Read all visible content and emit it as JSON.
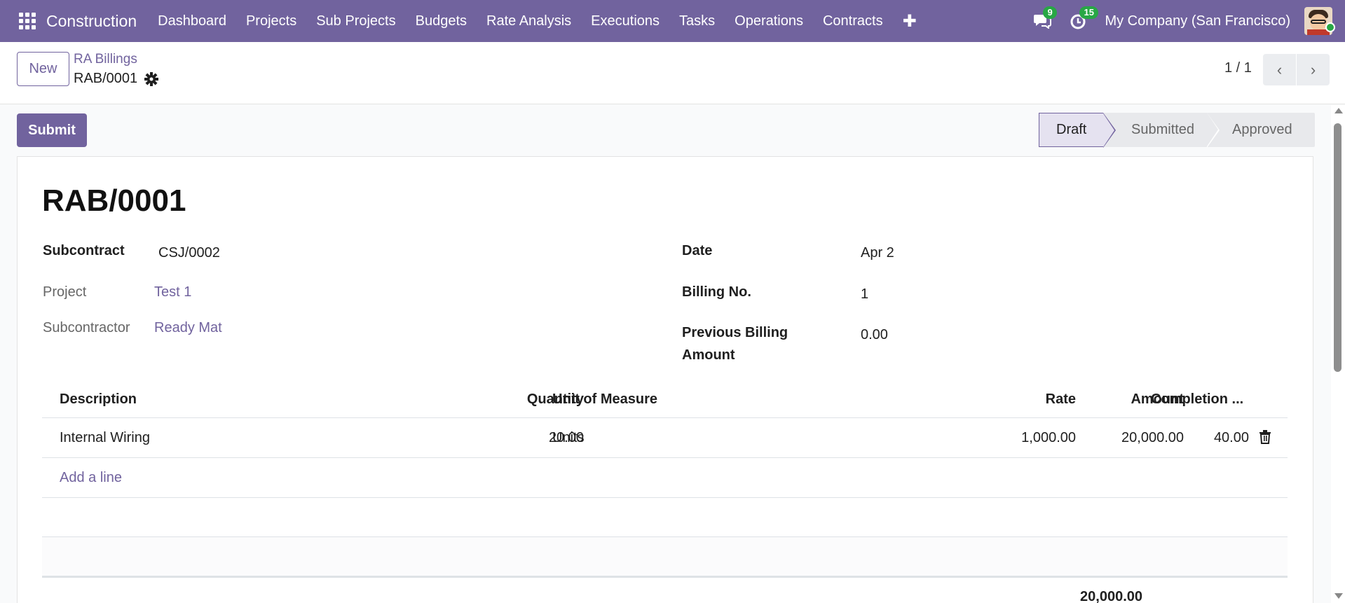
{
  "navbar": {
    "brand": "Construction",
    "menu": [
      "Dashboard",
      "Projects",
      "Sub Projects",
      "Budgets",
      "Rate Analysis",
      "Executions",
      "Tasks",
      "Operations",
      "Contracts"
    ],
    "messages_count": "9",
    "activities_count": "15",
    "company": "My Company (San Francisco)"
  },
  "control_panel": {
    "new_label": "New",
    "breadcrumb_parent": "RA Billings",
    "breadcrumb_current": "RAB/0001",
    "pager_value": "1 / 1"
  },
  "statusbar": {
    "submit_label": "Submit",
    "stages": [
      "Draft",
      "Submitted",
      "Approved"
    ],
    "active_stage": "Draft"
  },
  "form": {
    "title": "RAB/0001",
    "left": {
      "subcontract_label": "Subcontract",
      "subcontract_value": "CSJ/0002",
      "project_label": "Project",
      "project_value": "Test 1",
      "subcontractor_label": "Subcontractor",
      "subcontractor_value": "Ready Mat"
    },
    "right": {
      "date_label": "Date",
      "date_value": "Apr 2",
      "billing_no_label": "Billing No.",
      "billing_no_value": "1",
      "prev_billing_label_1": "Previous Billing",
      "prev_billing_label_2": "Amount",
      "prev_billing_value": "0.00"
    }
  },
  "table": {
    "columns": [
      "Description",
      "Quantity",
      "Unit of Measure",
      "Rate",
      "Amount",
      "Completion ..."
    ],
    "rows": [
      {
        "description": "Internal Wiring",
        "quantity": "20.00",
        "uom": "Units",
        "rate": "1,000.00",
        "amount": "20,000.00",
        "completion": "40.00"
      }
    ],
    "add_line_label": "Add a line",
    "total_amount": "20,000.00"
  },
  "colors": {
    "brand": "#71639e",
    "badge": "#28a745"
  }
}
